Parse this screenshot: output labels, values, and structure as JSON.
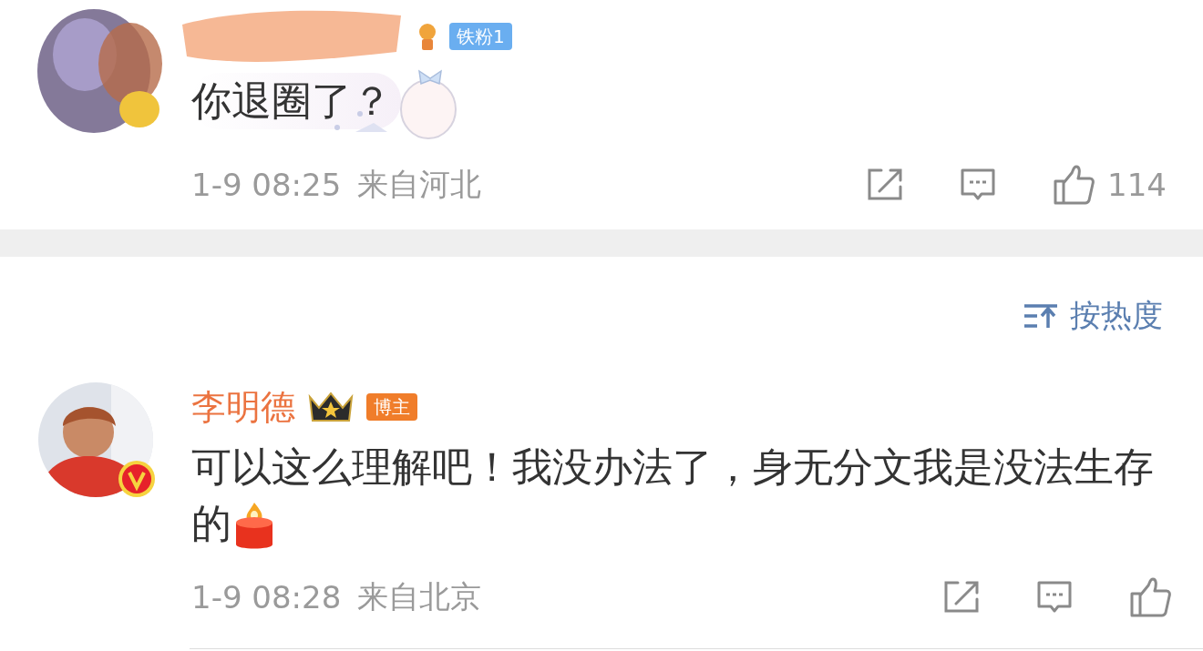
{
  "comments": [
    {
      "kind": "redacted",
      "badge": {
        "kind": "fan",
        "text": "铁粉1"
      },
      "text": "你退圈了？",
      "sticker": true,
      "time": "1-9 08:25",
      "location": "来自河北",
      "likes": "114"
    },
    {
      "kind": "verified",
      "name": "李明德",
      "badge": {
        "kind": "host",
        "text": "博主"
      },
      "text": "可以这么理解吧！我没办法了，身无分文我是没法生存的",
      "emoji": {
        "kind": "candle"
      },
      "time": "1-9 08:28",
      "location": "来自北京"
    }
  ],
  "sort": {
    "label": "按热度"
  }
}
